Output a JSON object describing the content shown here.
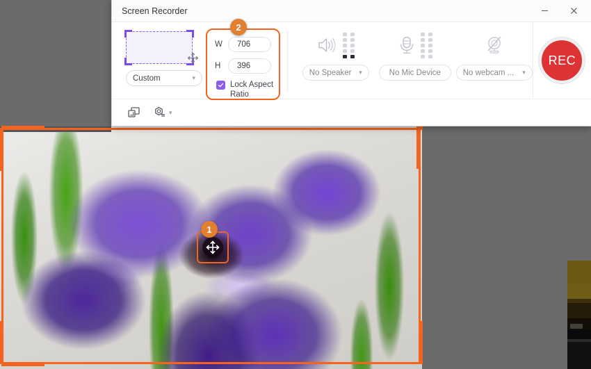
{
  "window": {
    "title": "Screen Recorder",
    "minimize_icon": "minimize-icon",
    "close_icon": "close-icon"
  },
  "region": {
    "preview_icon": "region-select-preview",
    "move_icon": "move-arrows-icon",
    "preset_value": "Custom",
    "chevron": "▾"
  },
  "size": {
    "badge": "2",
    "width_label": "W",
    "width_value": "706",
    "height_label": "H",
    "height_value": "396",
    "lock_label": "Lock Aspect Ratio",
    "lock_checked": true,
    "highlight_color": "#f4641e"
  },
  "devices": {
    "speaker": {
      "icon": "speaker-icon",
      "meter_icon": "level-meter-icon",
      "value": "No Speaker",
      "chevron": "▾"
    },
    "microphone": {
      "icon": "microphone-icon",
      "meter_icon": "level-meter-icon",
      "value": "No Mic Device"
    },
    "webcam": {
      "icon": "webcam-off-icon",
      "value": "No webcam ...",
      "chevron": "▾"
    }
  },
  "record": {
    "label": "REC",
    "color": "#dd3335"
  },
  "bottom_toolbar": {
    "screen_icon": "screen-capture-icon",
    "settings_icon": "settings-gear-icon",
    "settings_chevron": "▾"
  },
  "capture": {
    "frame_color": "#f4641e",
    "move_badge": "1",
    "move_icon": "move-arrows-icon"
  },
  "desktop": {
    "background_color": "#6b6b6b"
  }
}
